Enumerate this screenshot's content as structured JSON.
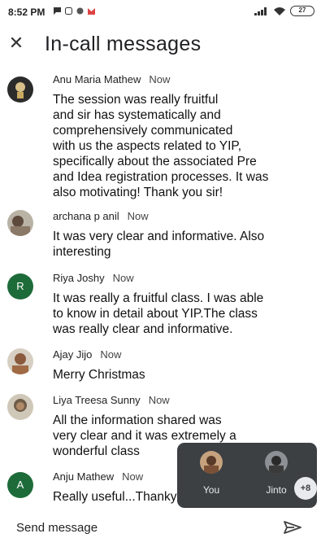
{
  "status_bar": {
    "time": "8:52 PM",
    "battery": "27"
  },
  "header": {
    "close_icon": "close-icon",
    "title": "In-call messages"
  },
  "messages": [
    {
      "sender": "Anu Maria Mathew",
      "time": "Now",
      "lines": [
        "The session was really fruitful",
        "and sir has systematically and",
        "comprehensively communicated",
        "with us the aspects related to YIP,",
        "specifically about the associated Pre",
        "and Idea registration processes. It was",
        "also motivating! Thank you sir!"
      ]
    },
    {
      "sender": "archana p anil",
      "time": "Now",
      "lines": [
        "It was very clear and informative. Also",
        "interesting"
      ]
    },
    {
      "sender": "Riya Joshy",
      "time": "Now",
      "avatar_letter": "R",
      "lines": [
        "It was really a fruitful class. I was able",
        "to know in detail about YIP.The class",
        "was really clear and informative."
      ]
    },
    {
      "sender": "Ajay Jijo",
      "time": "Now",
      "lines": [
        "Merry Christmas"
      ]
    },
    {
      "sender": "Liya Treesa Sunny",
      "time": "Now",
      "lines": [
        "All the information shared was",
        "very clear and it was extremely a",
        "wonderful class"
      ]
    },
    {
      "sender": "Anju Mathew",
      "time": "Now",
      "avatar_letter": "A",
      "lines": [
        "Really useful...Thankyou sir.."
      ]
    }
  ],
  "participants": {
    "tiles": [
      {
        "name": "You"
      },
      {
        "name": "Jinto"
      }
    ],
    "more_count": "+8"
  },
  "composer": {
    "placeholder": "Send message",
    "send_icon": "send-icon"
  },
  "colors": {
    "avatar_green": "#1e6b3a",
    "tile_background": "#3c4043"
  }
}
